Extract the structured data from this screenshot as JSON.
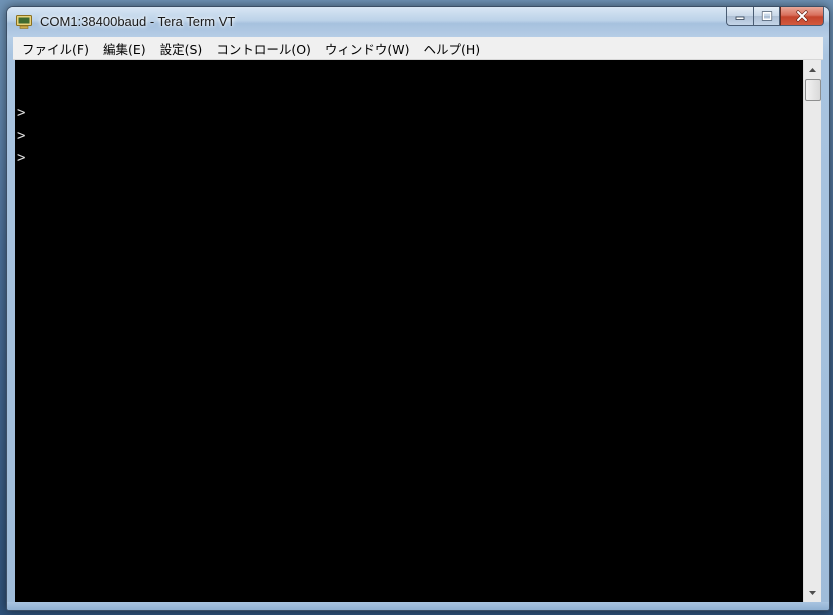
{
  "window": {
    "title": "COM1:38400baud - Tera Term VT",
    "icon": "tera-term-app-icon"
  },
  "caption": {
    "minimize_icon": "minimize-icon",
    "maximize_icon": "maximize-icon",
    "close_icon": "close-icon"
  },
  "menu": {
    "items": [
      {
        "label": "ファイル(F)"
      },
      {
        "label": "編集(E)"
      },
      {
        "label": "設定(S)"
      },
      {
        "label": "コントロール(O)"
      },
      {
        "label": "ウィンドウ(W)"
      },
      {
        "label": "ヘルプ(H)"
      }
    ]
  },
  "terminal": {
    "background": "#000000",
    "foreground": "#e0e0e0",
    "lines": [
      ">",
      ">",
      ">"
    ]
  },
  "scrollbar": {
    "up_icon": "scroll-up-arrow-icon",
    "down_icon": "scroll-down-arrow-icon"
  }
}
